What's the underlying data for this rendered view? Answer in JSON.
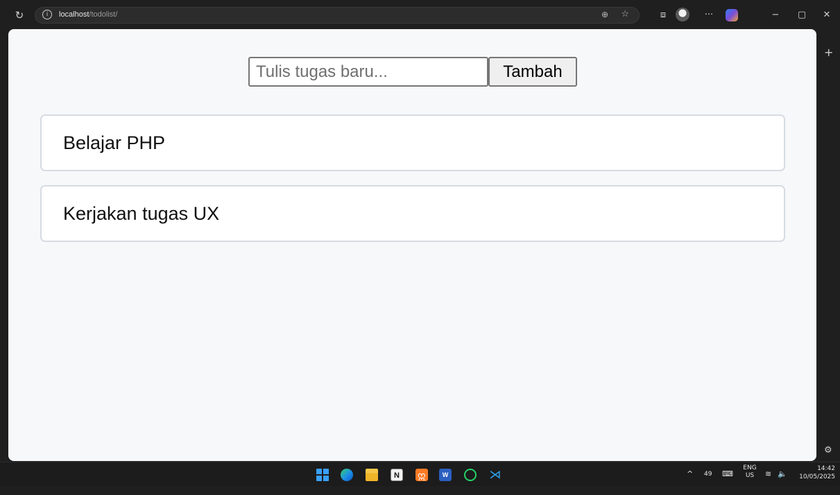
{
  "browser": {
    "url_host": "localhost",
    "url_path": "/todolist/",
    "icons": {
      "reload": "reload-icon",
      "site_info": "info-icon",
      "zoom": "zoom-icon",
      "favorite": "star-icon",
      "screen_share": "screen-icon",
      "profile": "avatar-icon",
      "more": "more-icon",
      "copilot": "copilot-icon",
      "minimize": "minimize-icon",
      "maximize": "maximize-icon",
      "close": "close-icon",
      "sidebar_add": "plus-icon",
      "sidebar_settings": "gear-icon"
    }
  },
  "todo": {
    "input_placeholder": "Tulis tugas baru...",
    "add_button_label": "Tambah",
    "tasks": [
      {
        "text": "Belajar PHP"
      },
      {
        "text": "Kerjakan tugas UX"
      }
    ]
  },
  "taskbar": {
    "apps": [
      "start-icon",
      "edge-icon",
      "file-explorer-icon",
      "notion-icon",
      "xampp-icon",
      "word-icon",
      "whatsapp-icon",
      "vscode-icon"
    ],
    "tray": {
      "notification_count": "49",
      "lang_top": "ENG",
      "lang_bottom": "US",
      "time": "14:42",
      "date": "10/05/2025"
    }
  },
  "colors": {
    "page_bg": "#f7f8fa",
    "card_border": "#d6dbe2",
    "chrome_bg": "#1f1f1f"
  }
}
